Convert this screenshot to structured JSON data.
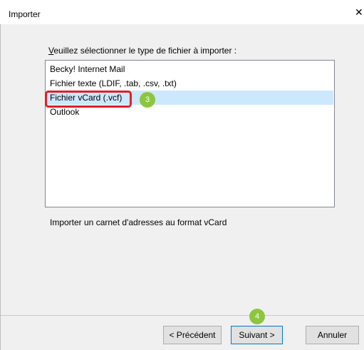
{
  "window": {
    "title": "Importer",
    "close_glyph": "✕"
  },
  "prompt": {
    "accel": "V",
    "rest": "euillez sélectionner le type de fichier à importer :"
  },
  "list": {
    "items": [
      "Becky! Internet Mail",
      "Fichier texte (LDIF, .tab, .csv, .txt)",
      "Fichier vCard (.vcf)",
      "Outlook"
    ],
    "selected_index": 2
  },
  "description": "Importer un carnet d'adresses au format vCard",
  "annotations": {
    "step3": "3",
    "step4": "4"
  },
  "buttons": {
    "back": "< Précédent",
    "next": "Suivant >",
    "cancel": "Annuler"
  },
  "colors": {
    "selection": "#cce8ff",
    "highlight_border": "#e0202a",
    "badge": "#8cc63f"
  }
}
